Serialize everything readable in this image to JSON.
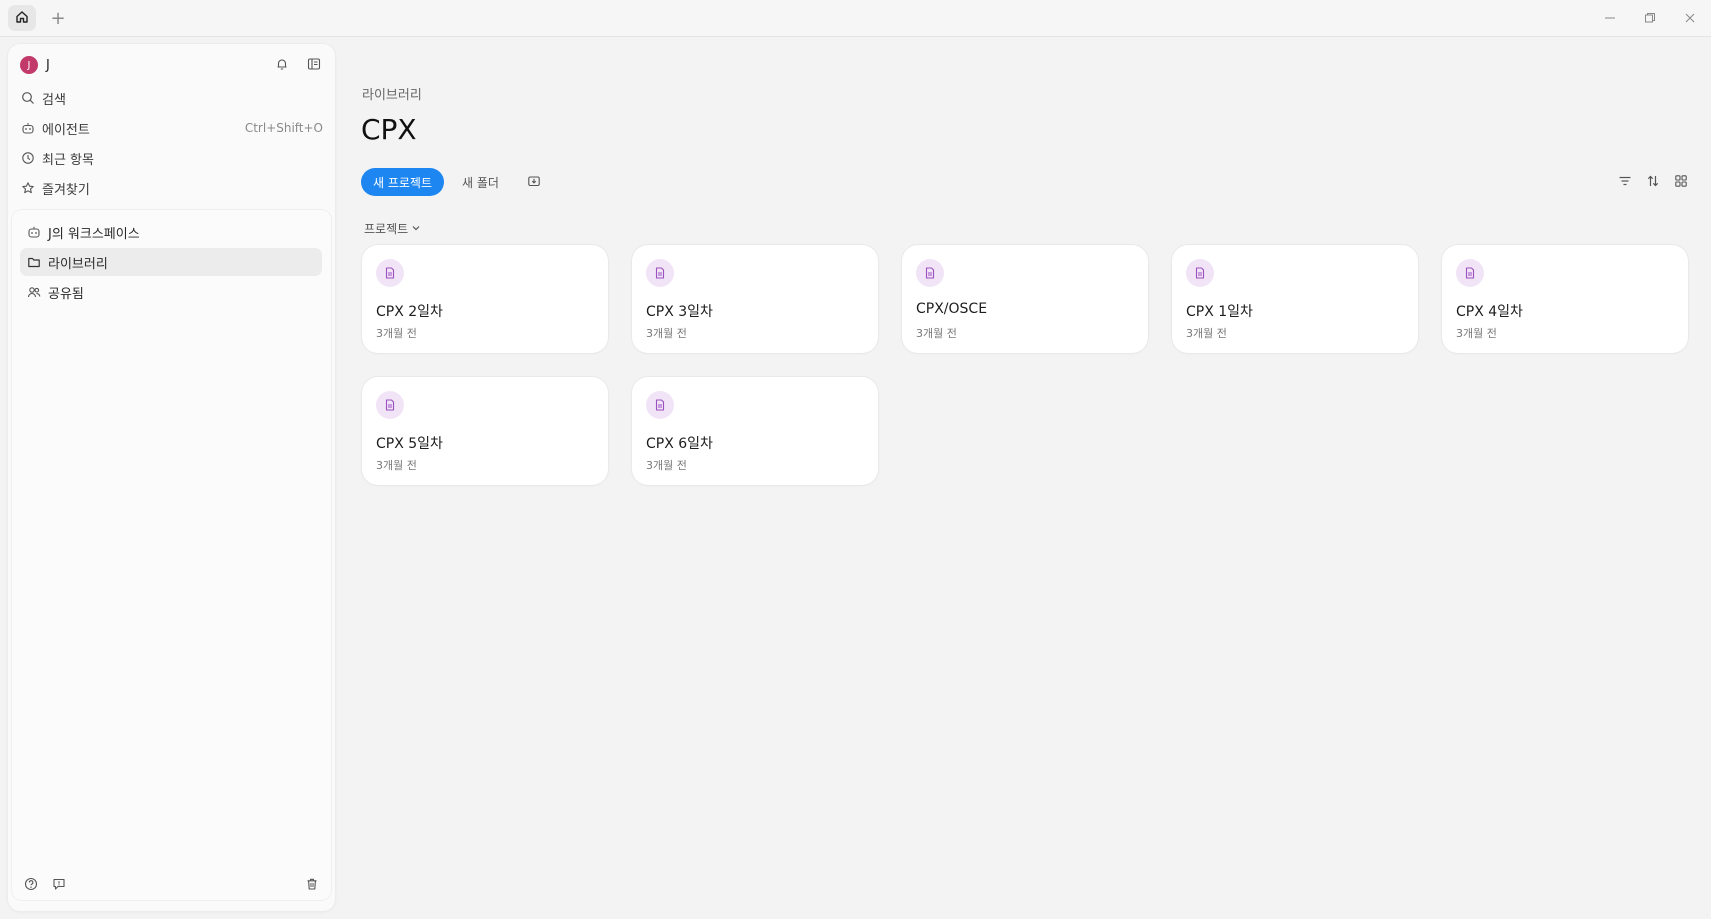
{
  "titlebar": {
    "tabs": [
      {
        "icon": "home-icon"
      }
    ],
    "new_tab_label": "+"
  },
  "sidebar": {
    "user": {
      "initial": "J",
      "name": "J"
    },
    "nav": [
      {
        "icon": "search-icon",
        "label": "검색"
      },
      {
        "icon": "agent-icon",
        "label": "에이전트",
        "shortcut": "Ctrl+Shift+O"
      },
      {
        "icon": "clock-icon",
        "label": "최근 항목"
      },
      {
        "icon": "star-icon",
        "label": "즐겨찾기"
      }
    ],
    "workspace": [
      {
        "icon": "workspace-icon",
        "label": "J의 워크스페이스"
      },
      {
        "icon": "folder-icon",
        "label": "라이브러리",
        "active": true
      },
      {
        "icon": "users-icon",
        "label": "공유됨"
      }
    ]
  },
  "main": {
    "breadcrumb": "라이브러리",
    "title": "CPX",
    "new_project_label": "새 프로젝트",
    "new_folder_label": "새 폴더",
    "section_label": "프로젝트",
    "projects": [
      {
        "title": "CPX 2일차",
        "time": "3개월 전"
      },
      {
        "title": "CPX 3일차",
        "time": "3개월 전"
      },
      {
        "title": "CPX/OSCE",
        "time": "3개월 전"
      },
      {
        "title": "CPX 1일차",
        "time": "3개월 전"
      },
      {
        "title": "CPX 4일차",
        "time": "3개월 전"
      },
      {
        "title": "CPX 5일차",
        "time": "3개월 전"
      },
      {
        "title": "CPX 6일차",
        "time": "3개월 전"
      }
    ]
  },
  "colors": {
    "accent": "#1e86f0",
    "avatar": "#c23a6a",
    "project_icon_bg": "#f1e4f7",
    "project_icon": "#9b4fc0"
  }
}
